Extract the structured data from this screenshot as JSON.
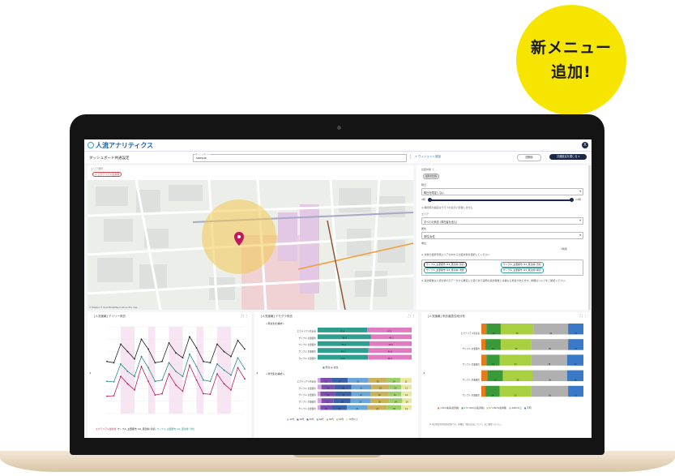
{
  "badge": {
    "line1": "新メニュー",
    "line2": "追加!"
  },
  "app": {
    "name": "人流アナリティクス",
    "close_label": "X"
  },
  "toolbar": {
    "title": "ダッシュボード共通設定",
    "select_label": "ダッシュボード",
    "select_value": "sample",
    "add_label": "+ ウィジェット追加",
    "reset_label": "初期化",
    "apply_label": "共通設定を閉じる ▾"
  },
  "map_panel": {
    "filter_label": "エリア選択",
    "chip": "× エクテリアル生産者",
    "credit": "© Mapbox © OpenStreetMap Improve this map"
  },
  "settings": {
    "row1_label": "比較対象 ⓘ",
    "row1_chip": "最新の比較",
    "period_label": "曜日",
    "period_value": "曜日を限定しない",
    "range_left": "0時",
    "range_right": "24時",
    "note1": "※ 時間帯の指定はグラフの表示に影響しません",
    "area_label": "エリア",
    "area_value": "すべての来訪 (滞在者を含む)",
    "attr_label": "属性",
    "attr_value": "男性/女性",
    "unit_label": "単位",
    "unit_value": "1時間",
    "note2": "※ 対象の選択可能エリアの中から比較対象を選択してください",
    "chips": [
      "サンプル_主要都市 (22_東急線) 新宿",
      "サンプル_主要都市 (22_東急線) 渋谷",
      "サンプル_主要都市 (22_東急線) 池袋",
      "サンプル_主要都市 (22_東急線) 横浜"
    ],
    "note3": "※ 来訪者数は人流分析の元データから推定した値であり実際の来訪者数とは異なる場合があります。詳細はヘルプをご確認ください。"
  },
  "panels": {
    "p1_title": "[人流速報] デイリー来訪",
    "p2_title": "[人流速報] デモグラ来訪",
    "p3_title": "[人流速報] 来訪者居住地分布",
    "p1_legend": [
      "エクテリアル生産者",
      "サンプル_主要都市 (22_東急線) 新宿",
      "サンプル_主要都市 (22_東急線) 渋谷"
    ],
    "p2_section1": "<男女別の構成>",
    "p2_section2": "<年代別の構成>",
    "p2_legend1": [
      "男性",
      "女性"
    ],
    "p2_legend2": [
      "10代",
      "20代",
      "30代",
      "40代",
      "50代",
      "60代",
      "70代以上"
    ],
    "p3_legend": [
      "1.5km未満(徒歩圏)",
      "1.5〜5km(自転車圏)",
      "5〜20km(電車圏)",
      "20km以上",
      "不明"
    ],
    "p3_note": "※ 来訪者居住地は推定値です。詳細は「集計方法について」をご確認ください。"
  },
  "colors": {
    "accent": "#1c5fa8",
    "badge": "#f5e500",
    "dark": "#1b2a4a"
  },
  "chart_data": [
    {
      "type": "line",
      "title": "",
      "ylabel": "",
      "series": [
        {
          "name": "エクテリアル生産者",
          "values": [
            70,
            72,
            150,
            120,
            95,
            190,
            130,
            75,
            80,
            160,
            115,
            90,
            195,
            135,
            80,
            78,
            160,
            120,
            95,
            185,
            140
          ]
        },
        {
          "name": "サンプル_主要都市 (22_東急線) 新宿",
          "values": [
            210,
            205,
            280,
            250,
            220,
            300,
            260,
            205,
            210,
            285,
            245,
            225,
            310,
            265,
            210,
            205,
            280,
            250,
            230,
            295,
            260
          ]
        },
        {
          "name": "サンプル_主要都市 (22_東急線) 渋谷",
          "values": [
            130,
            128,
            200,
            170,
            150,
            230,
            185,
            130,
            135,
            205,
            170,
            150,
            240,
            190,
            135,
            130,
            200,
            175,
            155,
            225,
            180
          ]
        }
      ]
    },
    {
      "type": "bar",
      "title": "<男女別の構成>",
      "categories": [
        "エクテリアル生産者",
        "サンプル 主要都市",
        "サンプル 主要都市",
        "サンプル 主要都市",
        "サンプル 主要都市"
      ],
      "series": [
        {
          "name": "男性",
          "values": [
            52.8,
            56.8,
            55.2,
            54.1,
            53.6
          ]
        },
        {
          "name": "女性",
          "values": [
            47.2,
            43.2,
            44.8,
            45.9,
            46.4
          ]
        }
      ]
    },
    {
      "type": "bar",
      "title": "<年代別の構成>",
      "categories": [
        "エクテリアル生産者",
        "サンプル 主要都市",
        "サンプル 主要都市",
        "サンプル 主要都市",
        "サンプル 主要都市"
      ],
      "series": [
        {
          "name": "10代",
          "values": [
            3,
            4,
            3,
            4,
            3
          ]
        },
        {
          "name": "20代",
          "values": [
            12,
            14,
            16,
            13,
            12
          ]
        },
        {
          "name": "30代",
          "values": [
            17,
            18,
            17,
            18,
            16
          ]
        },
        {
          "name": "40代",
          "values": [
            22,
            21,
            20,
            21,
            22
          ]
        },
        {
          "name": "50代",
          "values": [
            20,
            19,
            19,
            20,
            21
          ]
        },
        {
          "name": "60代",
          "values": [
            14,
            13,
            14,
            14,
            15
          ]
        },
        {
          "name": "70代以上",
          "values": [
            12,
            11,
            11,
            10,
            11
          ]
        }
      ]
    },
    {
      "type": "bar",
      "title": "",
      "categories": [
        "エクテリアル生産者",
        "サンプル 主要都市",
        "サンプル 主要都市",
        "サンプル 主要都市",
        "サンプル 主要都市"
      ],
      "series": [
        {
          "name": "1.5km未満(徒歩圏)",
          "values": [
            5,
            4,
            5,
            6,
            4
          ]
        },
        {
          "name": "1.5〜5km(自転車圏)",
          "values": [
            14,
            15,
            13,
            15,
            14
          ]
        },
        {
          "name": "5〜20km(電車圏)",
          "values": [
            32,
            30,
            31,
            29,
            31
          ]
        },
        {
          "name": "20km以上",
          "values": [
            34,
            36,
            35,
            34,
            36
          ]
        },
        {
          "name": "不明",
          "values": [
            15,
            15,
            16,
            16,
            15
          ]
        }
      ]
    }
  ]
}
